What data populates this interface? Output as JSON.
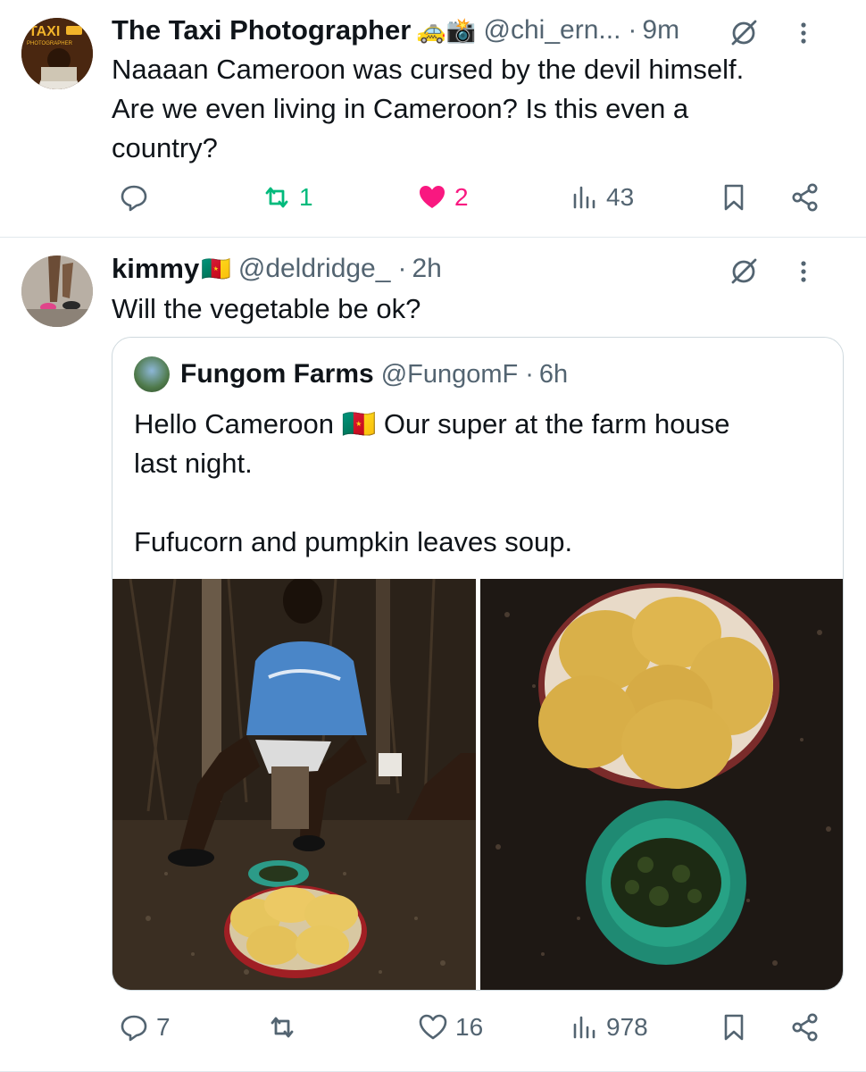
{
  "tweets": [
    {
      "name": "The Taxi Photographer",
      "emoji": "🚕📸",
      "handle": "@chi_ern...",
      "time": "9m",
      "text_lines": [
        "Naaaan Cameroon was cursed by the devil himself.",
        "Are we even living in Cameroon? Is this even a",
        "country?"
      ],
      "stats": {
        "reply": "",
        "retweet": "1",
        "like": "2",
        "views": "43"
      },
      "avatar_label": "TAXI",
      "avatar_sublabel": "PHOTOGRAPHER",
      "colors": {
        "retweet": "#00ba7c",
        "like": "#f91880"
      }
    },
    {
      "name": "kimmy",
      "emoji": "🇨🇲",
      "handle": "@deldridge_",
      "time": "2h",
      "text_lines": [
        "Will the vegetable be ok?"
      ],
      "stats": {
        "reply": "7",
        "retweet": "",
        "like": "16",
        "views": "978"
      }
    }
  ],
  "quote": {
    "name": "Fungom Farms",
    "handle": "@FungomF",
    "time": "6h",
    "lines": [
      "Hello Cameroon 🇨🇲 Our super at the farm house",
      "last night.",
      "",
      "Fufucorn and pumpkin leaves soup."
    ]
  },
  "separator": "·",
  "colors": {
    "text": "#0f1419",
    "secondary": "#536471",
    "border": "#cfd9de"
  }
}
